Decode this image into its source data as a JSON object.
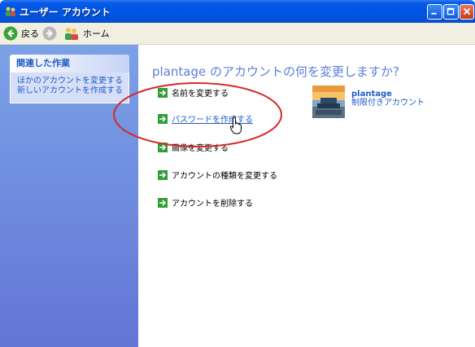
{
  "window": {
    "title": "ユーザー アカウント"
  },
  "toolbar": {
    "back_label": "戻る",
    "home_label": "ホーム"
  },
  "sidebar": {
    "header": "関連した作業",
    "links": [
      "ほかのアカウントを変更する",
      "新しいアカウントを作成する"
    ]
  },
  "main": {
    "question": "plantage のアカウントの何を変更しますか?",
    "actions": [
      "名前を変更する",
      "パスワードを作成する",
      "画像を変更する",
      "アカウントの種類を変更する",
      "アカウントを削除する"
    ]
  },
  "account": {
    "name": "plantage",
    "type": "制限付きアカウント"
  },
  "colors": {
    "titlebar": "#0055e5",
    "link": "#215dc6",
    "sidebar": "#6375d6",
    "highlight": "#d42a2a",
    "arrow": "#2f9e34"
  },
  "icons": {
    "back": "back-arrow-icon",
    "forward": "forward-arrow-icon",
    "home": "users-home-icon",
    "action": "green-arrow-icon"
  }
}
